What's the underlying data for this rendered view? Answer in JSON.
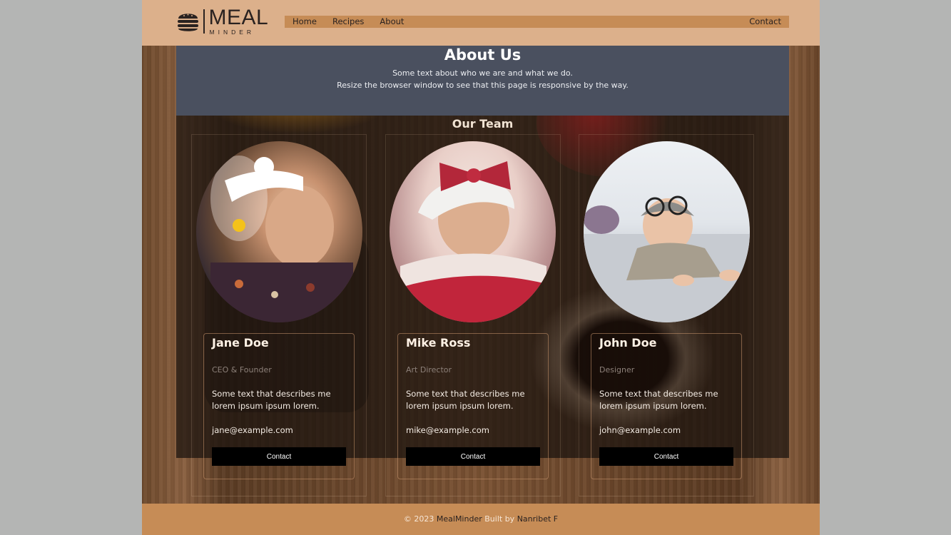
{
  "brand": {
    "word": "MEAL",
    "sub": "MINDER",
    "icon": "burger-icon"
  },
  "nav": [
    {
      "label": "Home"
    },
    {
      "label": "Recipes"
    },
    {
      "label": "About"
    },
    {
      "label": "Contact"
    }
  ],
  "about": {
    "title": "About Us",
    "line1": "Some text about who we are and what we do.",
    "line2": "Resize the browser window to see that this page is responsive by the way."
  },
  "team": {
    "title": "Our Team",
    "members": [
      {
        "name": "Jane Doe",
        "role": "CEO & Founder",
        "desc": "Some text that describes me lorem ipsum ipsum lorem.",
        "email": "jane@example.com",
        "button": "Contact"
      },
      {
        "name": "Mike Ross",
        "role": "Art Director",
        "desc": "Some text that describes me lorem ipsum ipsum lorem.",
        "email": "mike@example.com",
        "button": "Contact"
      },
      {
        "name": "John Doe",
        "role": "Designer",
        "desc": "Some text that describes me lorem ipsum ipsum lorem.",
        "email": "john@example.com",
        "button": "Contact"
      }
    ]
  },
  "footer": {
    "copy": "© 2023",
    "brand": "MealMinder",
    "built": "Built by",
    "author": "Nanribet F"
  },
  "colors": {
    "header": "#dcb08b",
    "nav": "#c68c56",
    "about": "#4a505f",
    "footer": "#c68c56",
    "button": "#000000"
  }
}
